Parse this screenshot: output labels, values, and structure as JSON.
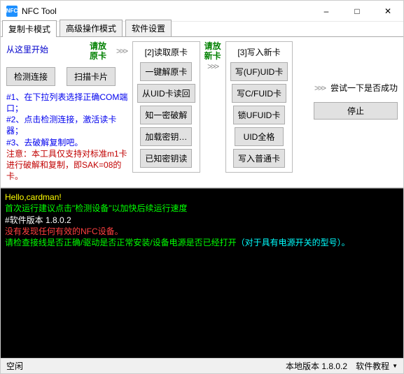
{
  "window": {
    "title": "NFC Tool",
    "icon_text": "NFC"
  },
  "tabs": {
    "t0": "复制卡模式",
    "t1": "高级操作模式",
    "t2": "软件设置"
  },
  "left": {
    "heading": "从这里开始",
    "detect_btn": "检测连接",
    "scan_btn": "扫描卡片",
    "place_card": "请放\n原卡"
  },
  "instr": {
    "l1": "#1、在下拉列表选择正确COM端口；",
    "l2": "#2、点击检测连接，激活读卡器；",
    "l3": "#3、去破解复制吧。",
    "l4": "注意：本工具仅支持对标准m1卡进行破解和复制，即SAK=08的卡。"
  },
  "group2": {
    "title": "[2]读取原卡",
    "b1": "一键解原卡",
    "b2": "从UID卡读回",
    "b3": "知一密破解",
    "b4": "加载密钥…",
    "b5": "已知密钥读"
  },
  "place_new": "请放\n新卡",
  "group3": {
    "title": "[3]写入新卡",
    "b1": "写(UF)UID卡",
    "b2": "写C/FUID卡",
    "b3": "锁UFUID卡",
    "b4": "UID全格",
    "b5": "写入普通卡"
  },
  "right": {
    "try_text": "尝试一下是否成功",
    "stop": "停止"
  },
  "arrows": ">>>",
  "console": {
    "l1": "Hello,cardman!",
    "l2": "首次运行建议点击\"检测设备\"以加快后续运行速度",
    "l3": "#软件版本 1.8.0.2",
    "l4": "没有发现任何有效的NFC设备。",
    "l5a": "请检查接线是否正确/驱动是否正常安装/设备电源是否已经打开",
    "l5b": "（对于具有电源开关的型号）。"
  },
  "status": {
    "state": "空闲",
    "version": "本地版本 1.8.0.2",
    "tutorial": "软件教程"
  }
}
